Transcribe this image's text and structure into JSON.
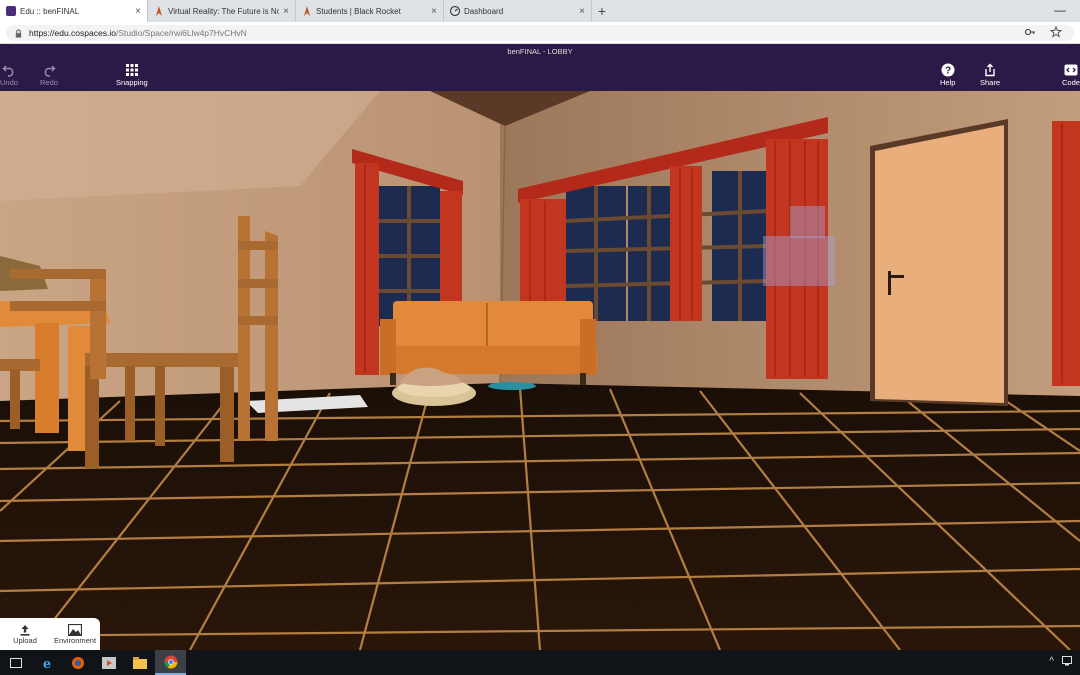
{
  "browser": {
    "tabs": [
      {
        "title": "Edu :: benFINAL",
        "icon": "cospaces-favicon",
        "active": true
      },
      {
        "title": "Virtual Reality: The Future is Now",
        "icon": "blackrocket-favicon",
        "active": false
      },
      {
        "title": "Students | Black Rocket",
        "icon": "blackrocket-favicon",
        "active": false
      },
      {
        "title": "Dashboard",
        "icon": "dashboard-favicon",
        "active": false
      }
    ],
    "close_glyph": "×",
    "new_tab_glyph": "+",
    "minimize_glyph": "—",
    "url_host": "https://edu.cospaces.io",
    "url_path": "/Studio/Space/rwi6Llw4p7HvCHvN",
    "key_icon": "key-icon",
    "star_icon": "star-icon"
  },
  "app": {
    "space_title": "benFINAL - LOBBY",
    "toolbar": {
      "undo_label": "Undo",
      "redo_label": "Redo",
      "snapping_label": "Snapping",
      "help_label": "Help",
      "share_label": "Share",
      "code_label": "Code"
    },
    "colors": {
      "header_bg": "#2b1a47",
      "dim_text": "#9a8fb0"
    }
  },
  "bottom_panel": {
    "upload_label": "Upload",
    "environment_label": "Environment"
  },
  "taskbar": {
    "items": [
      "task-view-icon",
      "ie-icon",
      "firefox-icon",
      "media-icon",
      "file-explorer-icon",
      "chrome-icon"
    ],
    "tray_caret": "^"
  }
}
